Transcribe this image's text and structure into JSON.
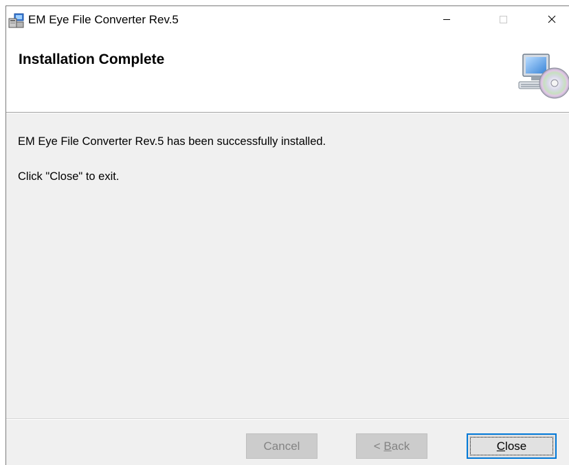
{
  "window": {
    "title": "EM Eye File Converter Rev.5",
    "app_icon": "installer-icon"
  },
  "caption_buttons": {
    "minimize_icon": "minimize-icon",
    "maximize_icon": "maximize-icon",
    "close_icon": "close-icon"
  },
  "banner": {
    "title": "Installation Complete",
    "image_icon": "computer-cd-icon"
  },
  "content": {
    "message": "EM Eye File Converter Rev.5 has been successfully installed.",
    "instruction": "Click \"Close\" to exit."
  },
  "buttons": {
    "cancel": "Cancel",
    "back_prefix": "< ",
    "back_mnemonic": "B",
    "back_rest": "ack",
    "close_mnemonic": "C",
    "close_rest": "lose"
  },
  "colors": {
    "focus_border": "#0078d7",
    "panel_bg": "#f0f0f0",
    "disabled_text": "#838383"
  }
}
